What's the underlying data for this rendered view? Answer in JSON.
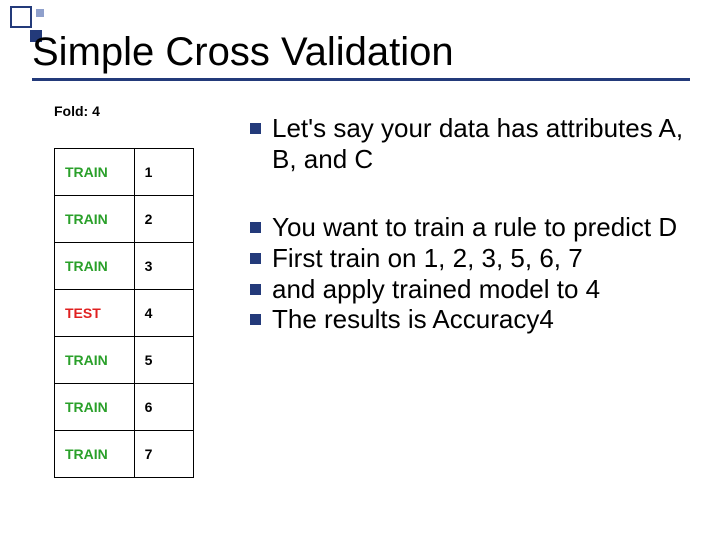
{
  "title": "Simple Cross Validation",
  "fold_label": "Fold: 4",
  "table": {
    "rows": [
      {
        "type": "train",
        "label": "TRAIN",
        "num": "1"
      },
      {
        "type": "train",
        "label": "TRAIN",
        "num": "2"
      },
      {
        "type": "train",
        "label": "TRAIN",
        "num": "3"
      },
      {
        "type": "test",
        "label": "TEST",
        "num": "4"
      },
      {
        "type": "train",
        "label": "TRAIN",
        "num": "5"
      },
      {
        "type": "train",
        "label": "TRAIN",
        "num": "6"
      },
      {
        "type": "train",
        "label": "TRAIN",
        "num": "7"
      }
    ]
  },
  "bullets_group1": [
    "Let's say your data has attributes A, B, and C"
  ],
  "bullets_group2": [
    "You want to train a rule to predict D",
    "First train on 1, 2, 3, 5, 6, 7",
    "and apply trained model to 4",
    "The results is Accuracy4"
  ]
}
